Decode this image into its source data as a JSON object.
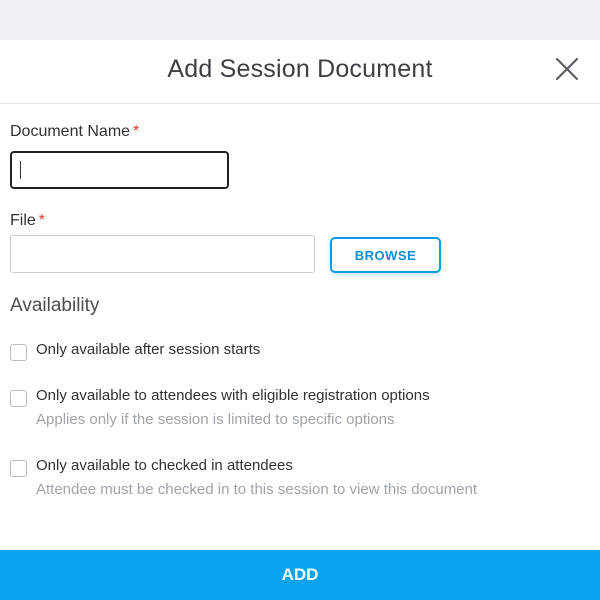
{
  "modal": {
    "title": "Add Session Document",
    "close_icon": "close-icon"
  },
  "form": {
    "document_name": {
      "label": "Document Name",
      "required_mark": "*",
      "value": ""
    },
    "file": {
      "label": "File",
      "required_mark": "*",
      "value": "",
      "browse_label": "BROWSE"
    },
    "availability": {
      "heading": "Availability",
      "options": [
        {
          "label": "Only available after session starts",
          "hint": "",
          "checked": false
        },
        {
          "label": "Only available to attendees with eligible registration options",
          "hint": "Applies only if the session is limited to specific options",
          "checked": false
        },
        {
          "label": "Only available to checked in attendees",
          "hint": "Attendee must be checked in to this session to view this document",
          "checked": false
        }
      ]
    }
  },
  "footer": {
    "add_label": "ADD"
  },
  "colors": {
    "accent": "#0aa3f2",
    "browse_border": "#0d9be0",
    "required": "#e03a3a",
    "hint_text": "#9ea4ab"
  }
}
